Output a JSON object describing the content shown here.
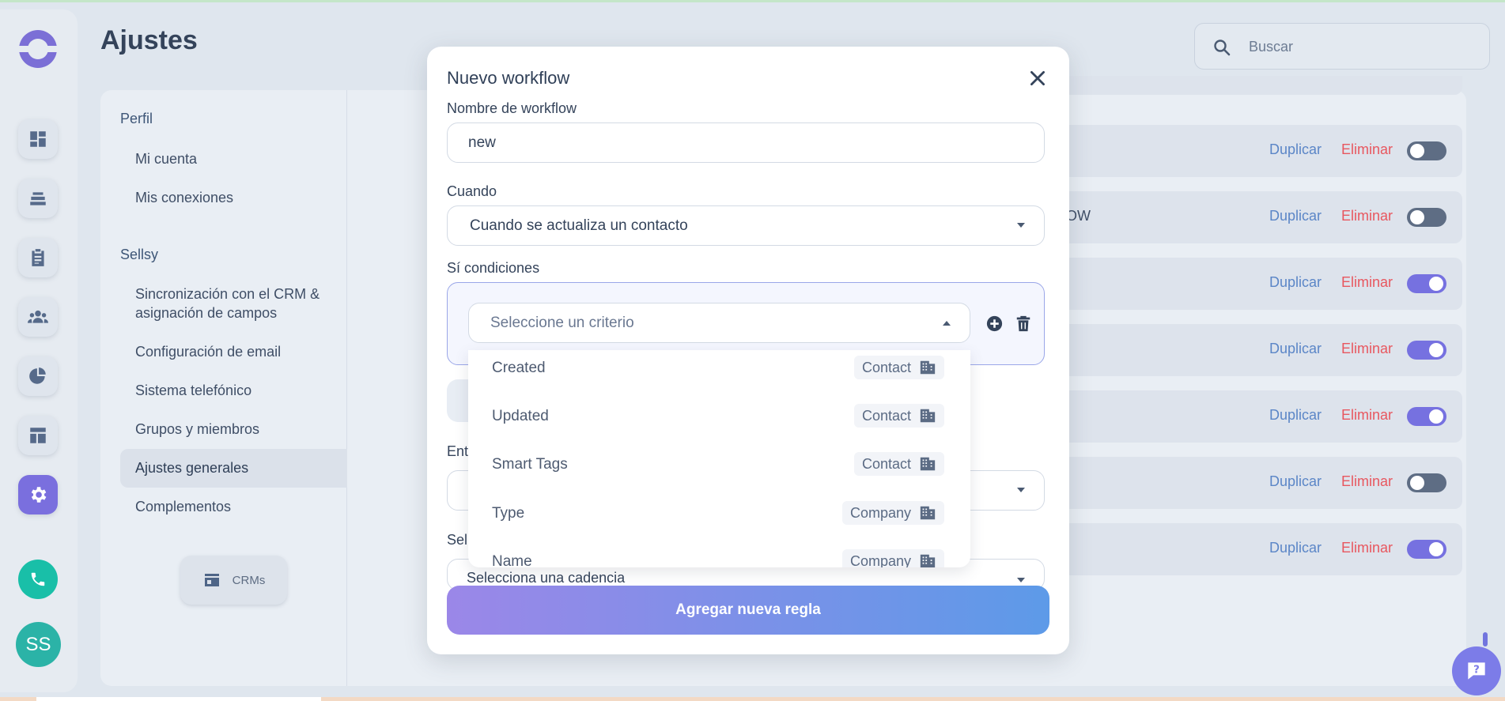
{
  "page": {
    "title": "Ajustes"
  },
  "search": {
    "placeholder": "Buscar"
  },
  "sidebar": {
    "sections": [
      {
        "heading": "Perfil",
        "items": [
          "Mi cuenta",
          "Mis conexiones"
        ]
      },
      {
        "heading": "Sellsy",
        "items": [
          "Sincronización con el CRM & asignación de campos",
          "Configuración de email",
          "Sistema telefónico",
          "Grupos y miembros",
          "Ajustes generales",
          "Complementos"
        ]
      }
    ],
    "active_item": "Ajustes generales",
    "crm_button": "CRMs"
  },
  "avatar": {
    "initials": "SS"
  },
  "workflows": {
    "duplicate_label": "Duplicar",
    "delete_label": "Eliminar",
    "rows": [
      {
        "name_fragment": "",
        "enabled": false
      },
      {
        "name_fragment": "OW",
        "enabled": false
      },
      {
        "name_fragment": "",
        "enabled": true
      },
      {
        "name_fragment": "",
        "enabled": true
      },
      {
        "name_fragment": "",
        "enabled": true
      },
      {
        "name_fragment": "",
        "enabled": false
      },
      {
        "name_fragment": "",
        "enabled": true
      }
    ]
  },
  "modal": {
    "title": "Nuevo workflow",
    "name_label": "Nombre de workflow",
    "name_value": "new",
    "when_label": "Cuando",
    "when_value": "Cuando se actualiza un contacto",
    "conditions_label": "Sí condiciones",
    "criteria_placeholder": "Seleccione un criterio",
    "criteria_options": [
      {
        "label": "Created",
        "tag": "Contact"
      },
      {
        "label": "Updated",
        "tag": "Contact"
      },
      {
        "label": "Smart Tags",
        "tag": "Contact"
      },
      {
        "label": "Type",
        "tag": "Company"
      },
      {
        "label": "Name",
        "tag": "Company"
      }
    ],
    "then_label_fragment": "Ent",
    "select_label_fragment": "Sel",
    "cadence_placeholder": "Selecciona una cadencia",
    "add_rule_button": "Agregar nueva regla"
  }
}
